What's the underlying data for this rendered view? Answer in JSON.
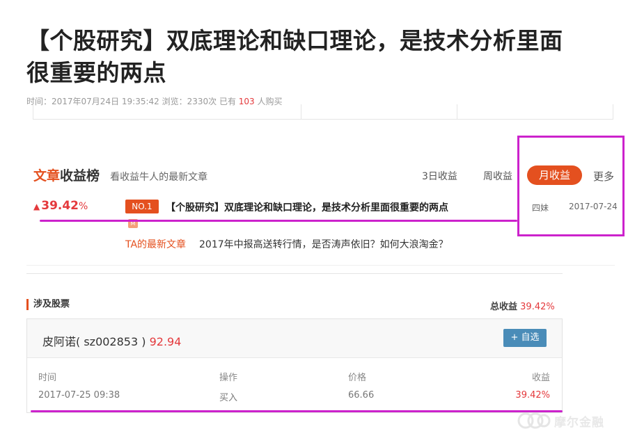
{
  "article": {
    "title": "【个股研究】双底理论和缺口理论，是技术分析里面很重要的两点",
    "meta_prefix": "时间：2017年07月24日 19:35:42  浏览：2330次  已有 ",
    "buyers": "103",
    "meta_suffix": " 人购买"
  },
  "ranking": {
    "title_part1": "文章",
    "title_part2": "收益榜",
    "subtitle": "看收益牛人的最新文章",
    "tabs": [
      "3日收益",
      "周收益",
      "月收益",
      "更多"
    ],
    "active_tab": "月收益",
    "top_entry": {
      "arrow": "▲",
      "return": "39.42",
      "return_unit": "%",
      "badge": "NO.1",
      "title": "【个股研究】双底理论和缺口理论，是技术分析里面很重要的两点",
      "author": "四妹",
      "date": "2017-07-24",
      "tag": "M"
    },
    "latest": {
      "label": "TA的最新文章",
      "title": "2017年中报高送转行情，是否涛声依旧？如何大浪淘金？"
    }
  },
  "stocks": {
    "heading": "涉及股票",
    "total_label": "总收益",
    "total_value": "39.42%",
    "card": {
      "name": "皮阿诺( sz002853 )",
      "price": "92.94",
      "add_button": "+ 自选",
      "columns": [
        "时间",
        "操作",
        "价格",
        "收益"
      ],
      "row": [
        "2017-07-25 09:38",
        "买入",
        "66.66",
        "39.42%"
      ]
    }
  },
  "watermark": {
    "text": "摩尔金融"
  },
  "colors": {
    "accent": "#e4501f",
    "red": "#e4393c",
    "annotation": "#cc22cc",
    "button_blue": "#4a8cb8"
  }
}
